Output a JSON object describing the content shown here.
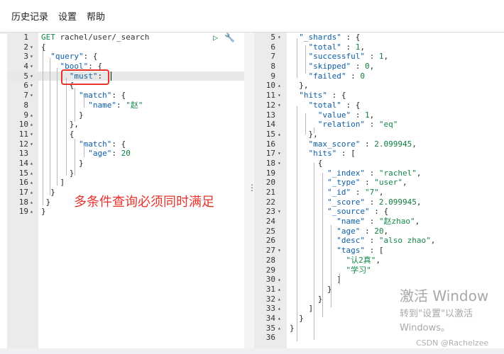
{
  "menu": [
    {
      "label": "历史记录"
    },
    {
      "label": "设置"
    },
    {
      "label": "帮助"
    }
  ],
  "annotation": "多条件查询必须同时满足",
  "request_lines": [
    {
      "n": "1",
      "fold": "",
      "tokens": [
        {
          "t": "GET ",
          "c": "kw"
        },
        {
          "t": "rachel/user/_search",
          "c": "url"
        }
      ]
    },
    {
      "n": "2",
      "fold": "▾",
      "tokens": [
        {
          "t": "{",
          "c": ""
        }
      ]
    },
    {
      "n": "3",
      "fold": "▾",
      "tokens": [
        {
          "t": "  ",
          "c": ""
        },
        {
          "t": "\"query\"",
          "c": "k"
        },
        {
          "t": ": {",
          "c": ""
        }
      ]
    },
    {
      "n": "4",
      "fold": "▾",
      "tokens": [
        {
          "t": "    ",
          "c": ""
        },
        {
          "t": "\"bool\"",
          "c": "k"
        },
        {
          "t": ": {",
          "c": ""
        }
      ]
    },
    {
      "n": "5",
      "fold": "▾",
      "tokens": [
        {
          "t": "      ",
          "c": ""
        },
        {
          "t": "\"must\"",
          "c": "k"
        },
        {
          "t": ":",
          "c": ""
        }
      ]
    },
    {
      "n": "6",
      "fold": "▾",
      "tokens": [
        {
          "t": "      ",
          "c": ""
        },
        {
          "t": "{",
          "c": ""
        }
      ]
    },
    {
      "n": "7",
      "fold": "▾",
      "tokens": [
        {
          "t": "        ",
          "c": ""
        },
        {
          "t": "\"match\"",
          "c": "k"
        },
        {
          "t": ": {",
          "c": ""
        }
      ]
    },
    {
      "n": "8",
      "fold": "",
      "tokens": [
        {
          "t": "          ",
          "c": ""
        },
        {
          "t": "\"name\"",
          "c": "k"
        },
        {
          "t": ": ",
          "c": ""
        },
        {
          "t": "\"赵\"",
          "c": "s"
        }
      ]
    },
    {
      "n": "9",
      "fold": "▴",
      "tokens": [
        {
          "t": "        ",
          "c": ""
        },
        {
          "t": "}",
          "c": ""
        }
      ]
    },
    {
      "n": "10",
      "fold": "▴",
      "tokens": [
        {
          "t": "      ",
          "c": ""
        },
        {
          "t": "},",
          "c": ""
        }
      ]
    },
    {
      "n": "11",
      "fold": "▾",
      "tokens": [
        {
          "t": "      ",
          "c": ""
        },
        {
          "t": "{",
          "c": ""
        }
      ]
    },
    {
      "n": "12",
      "fold": "▾",
      "tokens": [
        {
          "t": "        ",
          "c": ""
        },
        {
          "t": "\"match\"",
          "c": "k"
        },
        {
          "t": ": {",
          "c": ""
        }
      ]
    },
    {
      "n": "13",
      "fold": "",
      "tokens": [
        {
          "t": "          ",
          "c": ""
        },
        {
          "t": "\"age\"",
          "c": "k"
        },
        {
          "t": ": ",
          "c": ""
        },
        {
          "t": "20",
          "c": "n"
        }
      ]
    },
    {
      "n": "14",
      "fold": "▴",
      "tokens": [
        {
          "t": "        ",
          "c": ""
        },
        {
          "t": "}",
          "c": ""
        }
      ]
    },
    {
      "n": "15",
      "fold": "▴",
      "tokens": [
        {
          "t": "      ",
          "c": ""
        },
        {
          "t": "}",
          "c": ""
        }
      ]
    },
    {
      "n": "16",
      "fold": "▴",
      "tokens": [
        {
          "t": "    ",
          "c": ""
        },
        {
          "t": "]",
          "c": ""
        }
      ]
    },
    {
      "n": "17",
      "fold": "▴",
      "tokens": [
        {
          "t": "  ",
          "c": ""
        },
        {
          "t": "}",
          "c": ""
        }
      ]
    },
    {
      "n": "18",
      "fold": "▴",
      "tokens": [
        {
          "t": " ",
          "c": ""
        },
        {
          "t": "}",
          "c": ""
        }
      ]
    },
    {
      "n": "19",
      "fold": "▴",
      "tokens": [
        {
          "t": "}",
          "c": ""
        }
      ]
    }
  ],
  "response_lines": [
    {
      "n": "5",
      "fold": "▾",
      "tokens": [
        {
          "t": "  ",
          "c": ""
        },
        {
          "t": "\"_shards\"",
          "c": "k"
        },
        {
          "t": " : {",
          "c": ""
        }
      ]
    },
    {
      "n": "6",
      "fold": "",
      "tokens": [
        {
          "t": "    ",
          "c": ""
        },
        {
          "t": "\"total\"",
          "c": "k"
        },
        {
          "t": " : ",
          "c": ""
        },
        {
          "t": "1",
          "c": "n"
        },
        {
          "t": ",",
          "c": ""
        }
      ]
    },
    {
      "n": "7",
      "fold": "",
      "tokens": [
        {
          "t": "    ",
          "c": ""
        },
        {
          "t": "\"successful\"",
          "c": "k"
        },
        {
          "t": " : ",
          "c": ""
        },
        {
          "t": "1",
          "c": "n"
        },
        {
          "t": ",",
          "c": ""
        }
      ]
    },
    {
      "n": "8",
      "fold": "",
      "tokens": [
        {
          "t": "    ",
          "c": ""
        },
        {
          "t": "\"skipped\"",
          "c": "k"
        },
        {
          "t": " : ",
          "c": ""
        },
        {
          "t": "0",
          "c": "n"
        },
        {
          "t": ",",
          "c": ""
        }
      ]
    },
    {
      "n": "9",
      "fold": "",
      "tokens": [
        {
          "t": "    ",
          "c": ""
        },
        {
          "t": "\"failed\"",
          "c": "k"
        },
        {
          "t": " : ",
          "c": ""
        },
        {
          "t": "0",
          "c": "n"
        }
      ]
    },
    {
      "n": "10",
      "fold": "▴",
      "tokens": [
        {
          "t": "  ",
          "c": ""
        },
        {
          "t": "},",
          "c": ""
        }
      ]
    },
    {
      "n": "11",
      "fold": "▾",
      "tokens": [
        {
          "t": "  ",
          "c": ""
        },
        {
          "t": "\"hits\"",
          "c": "k"
        },
        {
          "t": " : {",
          "c": ""
        }
      ]
    },
    {
      "n": "12",
      "fold": "▾",
      "tokens": [
        {
          "t": "    ",
          "c": ""
        },
        {
          "t": "\"total\"",
          "c": "k"
        },
        {
          "t": " : {",
          "c": ""
        }
      ]
    },
    {
      "n": "13",
      "fold": "",
      "tokens": [
        {
          "t": "      ",
          "c": ""
        },
        {
          "t": "\"value\"",
          "c": "k"
        },
        {
          "t": " : ",
          "c": ""
        },
        {
          "t": "1",
          "c": "n"
        },
        {
          "t": ",",
          "c": ""
        }
      ]
    },
    {
      "n": "14",
      "fold": "",
      "tokens": [
        {
          "t": "      ",
          "c": ""
        },
        {
          "t": "\"relation\"",
          "c": "k"
        },
        {
          "t": " : ",
          "c": ""
        },
        {
          "t": "\"eq\"",
          "c": "s"
        }
      ]
    },
    {
      "n": "15",
      "fold": "▴",
      "tokens": [
        {
          "t": "    ",
          "c": ""
        },
        {
          "t": "},",
          "c": ""
        }
      ]
    },
    {
      "n": "16",
      "fold": "",
      "tokens": [
        {
          "t": "    ",
          "c": ""
        },
        {
          "t": "\"max_score\"",
          "c": "k"
        },
        {
          "t": " : ",
          "c": ""
        },
        {
          "t": "2.099945",
          "c": "n"
        },
        {
          "t": ",",
          "c": ""
        }
      ]
    },
    {
      "n": "17",
      "fold": "▾",
      "tokens": [
        {
          "t": "    ",
          "c": ""
        },
        {
          "t": "\"hits\"",
          "c": "k"
        },
        {
          "t": " : [",
          "c": ""
        }
      ]
    },
    {
      "n": "18",
      "fold": "▾",
      "tokens": [
        {
          "t": "      ",
          "c": ""
        },
        {
          "t": "{",
          "c": ""
        }
      ]
    },
    {
      "n": "19",
      "fold": "",
      "tokens": [
        {
          "t": "        ",
          "c": ""
        },
        {
          "t": "\"_index\"",
          "c": "k"
        },
        {
          "t": " : ",
          "c": ""
        },
        {
          "t": "\"rachel\"",
          "c": "s"
        },
        {
          "t": ",",
          "c": ""
        }
      ]
    },
    {
      "n": "20",
      "fold": "",
      "tokens": [
        {
          "t": "        ",
          "c": ""
        },
        {
          "t": "\"_type\"",
          "c": "k"
        },
        {
          "t": " : ",
          "c": ""
        },
        {
          "t": "\"user\"",
          "c": "s"
        },
        {
          "t": ",",
          "c": ""
        }
      ]
    },
    {
      "n": "21",
      "fold": "",
      "tokens": [
        {
          "t": "        ",
          "c": ""
        },
        {
          "t": "\"_id\"",
          "c": "k"
        },
        {
          "t": " : ",
          "c": ""
        },
        {
          "t": "\"7\"",
          "c": "s"
        },
        {
          "t": ",",
          "c": ""
        }
      ]
    },
    {
      "n": "22",
      "fold": "",
      "tokens": [
        {
          "t": "        ",
          "c": ""
        },
        {
          "t": "\"_score\"",
          "c": "k"
        },
        {
          "t": " : ",
          "c": ""
        },
        {
          "t": "2.099945",
          "c": "n"
        },
        {
          "t": ",",
          "c": ""
        }
      ]
    },
    {
      "n": "23",
      "fold": "▾",
      "tokens": [
        {
          "t": "        ",
          "c": ""
        },
        {
          "t": "\"_source\"",
          "c": "k"
        },
        {
          "t": " : {",
          "c": ""
        }
      ]
    },
    {
      "n": "24",
      "fold": "",
      "tokens": [
        {
          "t": "          ",
          "c": ""
        },
        {
          "t": "\"name\"",
          "c": "k"
        },
        {
          "t": " : ",
          "c": ""
        },
        {
          "t": "\"赵zhao\"",
          "c": "s"
        },
        {
          "t": ",",
          "c": ""
        }
      ]
    },
    {
      "n": "25",
      "fold": "",
      "tokens": [
        {
          "t": "          ",
          "c": ""
        },
        {
          "t": "\"age\"",
          "c": "k"
        },
        {
          "t": " : ",
          "c": ""
        },
        {
          "t": "20",
          "c": "n"
        },
        {
          "t": ",",
          "c": ""
        }
      ]
    },
    {
      "n": "26",
      "fold": "",
      "tokens": [
        {
          "t": "          ",
          "c": ""
        },
        {
          "t": "\"desc\"",
          "c": "k"
        },
        {
          "t": " : ",
          "c": ""
        },
        {
          "t": "\"also zhao\"",
          "c": "s"
        },
        {
          "t": ",",
          "c": ""
        }
      ]
    },
    {
      "n": "27",
      "fold": "▾",
      "tokens": [
        {
          "t": "          ",
          "c": ""
        },
        {
          "t": "\"tags\"",
          "c": "k"
        },
        {
          "t": " : [",
          "c": ""
        }
      ]
    },
    {
      "n": "28",
      "fold": "",
      "tokens": [
        {
          "t": "            ",
          "c": ""
        },
        {
          "t": "\"认2真\"",
          "c": "s"
        },
        {
          "t": ",",
          "c": ""
        }
      ]
    },
    {
      "n": "29",
      "fold": "",
      "tokens": [
        {
          "t": "            ",
          "c": ""
        },
        {
          "t": "\"学习\"",
          "c": "s"
        }
      ]
    },
    {
      "n": "30",
      "fold": "▴",
      "tokens": [
        {
          "t": "          ",
          "c": ""
        },
        {
          "t": "]",
          "c": ""
        }
      ]
    },
    {
      "n": "31",
      "fold": "▴",
      "tokens": [
        {
          "t": "        ",
          "c": ""
        },
        {
          "t": "}",
          "c": ""
        }
      ]
    },
    {
      "n": "32",
      "fold": "▴",
      "tokens": [
        {
          "t": "      ",
          "c": ""
        },
        {
          "t": "}",
          "c": ""
        }
      ]
    },
    {
      "n": "33",
      "fold": "▴",
      "tokens": [
        {
          "t": "    ",
          "c": ""
        },
        {
          "t": "]",
          "c": ""
        }
      ]
    },
    {
      "n": "34",
      "fold": "▴",
      "tokens": [
        {
          "t": "  ",
          "c": ""
        },
        {
          "t": "}",
          "c": ""
        }
      ]
    },
    {
      "n": "35",
      "fold": "▴",
      "tokens": [
        {
          "t": "}",
          "c": ""
        }
      ]
    },
    {
      "n": "36",
      "fold": "",
      "tokens": []
    }
  ],
  "icons": {
    "run": "play-icon",
    "settings": "wrench-icon",
    "divider": "drag-handle-icon"
  },
  "watermark": {
    "title": "激活 Window",
    "line1": "转到\"设置\"以激活",
    "line2": "Windows。"
  },
  "credit": "CSDN @Rachelzee",
  "colors": {
    "key": "#0b5da8",
    "string": "#13884a",
    "number": "#0f7f3c",
    "highlight": "#e8322b"
  }
}
